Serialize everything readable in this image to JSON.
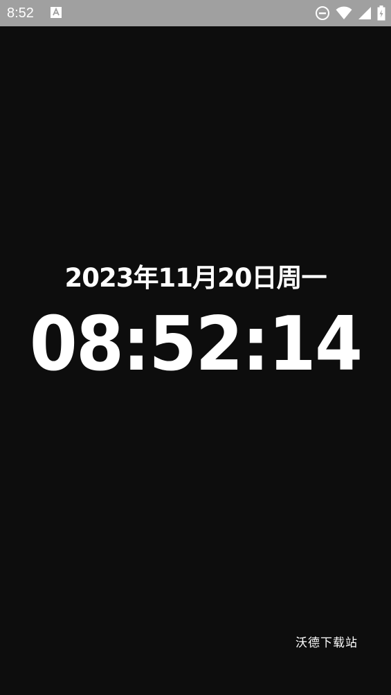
{
  "status_bar": {
    "time": "8:52",
    "icons": [
      "notification-a-icon",
      "do-not-disturb-icon",
      "wifi-icon",
      "signal-icon",
      "battery-charging-icon"
    ]
  },
  "clock": {
    "date": "2023年11月20日周一",
    "time": "08:52:14"
  },
  "watermark": {
    "text": "沃德下载站"
  },
  "colors": {
    "background": "#0d0d0d",
    "status_bar": "#a0a0a0",
    "text": "#ffffff"
  }
}
